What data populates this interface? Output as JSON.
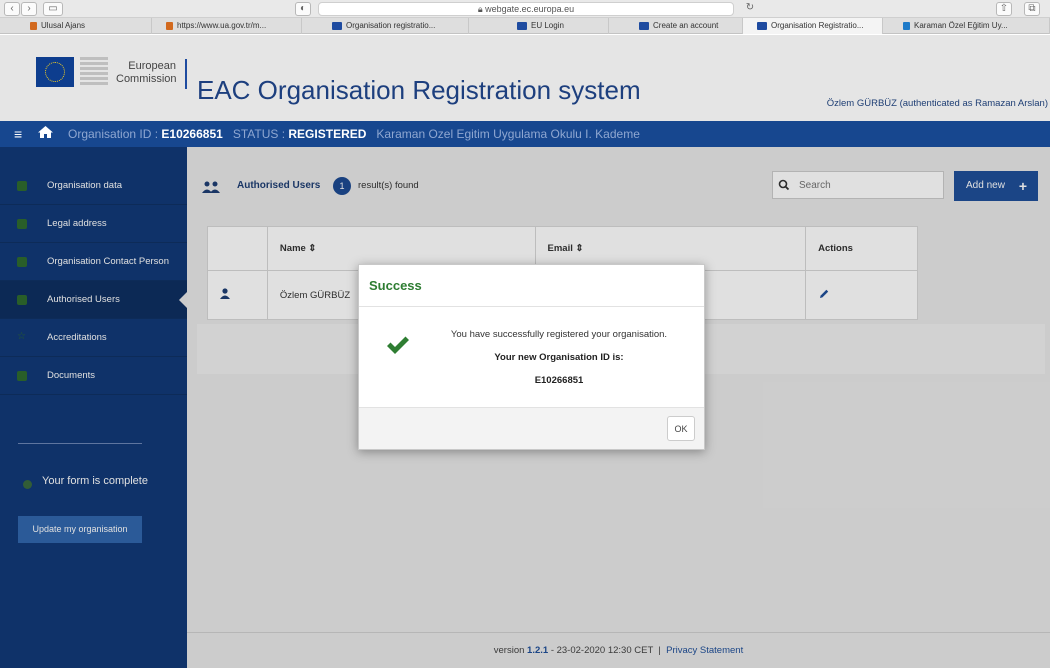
{
  "browser": {
    "url": "webgate.ec.europa.eu",
    "tabs": [
      {
        "label": "Ulusal Ajans"
      },
      {
        "label": "https://www.ua.gov.tr/m..."
      },
      {
        "label": "Organisation registratio..."
      },
      {
        "label": "EU Login"
      },
      {
        "label": "Create an account"
      },
      {
        "label": "Organisation Registratio..."
      },
      {
        "label": "Karaman Özel Eğitim Uy..."
      }
    ]
  },
  "header": {
    "ec_line1": "European",
    "ec_line2": "Commission",
    "app_title": "EAC Organisation Registration system",
    "user_info": "Özlem GÜRBÜZ (authenticated as Ramazan Arslan)"
  },
  "org_bar": {
    "id_label": "Organisation ID :",
    "id_value": "E10266851",
    "status_label": "STATUS :",
    "status_value": "REGISTERED",
    "org_name": "Karaman Ozel Egitim Uygulama Okulu I. Kademe"
  },
  "sidebar": {
    "items": [
      {
        "label": "Organisation data"
      },
      {
        "label": "Legal address"
      },
      {
        "label": "Organisation Contact Person"
      },
      {
        "label": "Authorised Users"
      },
      {
        "label": "Accreditations"
      },
      {
        "label": "Documents"
      }
    ],
    "form_status": "Your form is complete",
    "update_button": "Update my organisation"
  },
  "main": {
    "panel_title": "Authorised Users",
    "count": "1",
    "results_text": "result(s) found",
    "search_placeholder": "Search",
    "add_new_label": "Add new",
    "columns": {
      "name": "Name ⇕",
      "email": "Email ⇕",
      "actions": "Actions"
    },
    "rows": [
      {
        "name": "Özlem GÜRBÜZ"
      }
    ]
  },
  "footer": {
    "version_prefix": "version",
    "version": "1.2.1",
    "date_text": "- 23-02-2020 12:30 CET",
    "separator": "|",
    "privacy": "Privacy Statement"
  },
  "modal": {
    "title": "Success",
    "message": "You have successfully registered your organisation.",
    "id_label": "Your new Organisation ID is:",
    "id_value": "E10266851",
    "ok_label": "OK"
  },
  "colors": {
    "primary_blue": "#17478f",
    "sidebar_blue": "#123a78",
    "success_green": "#2e7d32"
  }
}
